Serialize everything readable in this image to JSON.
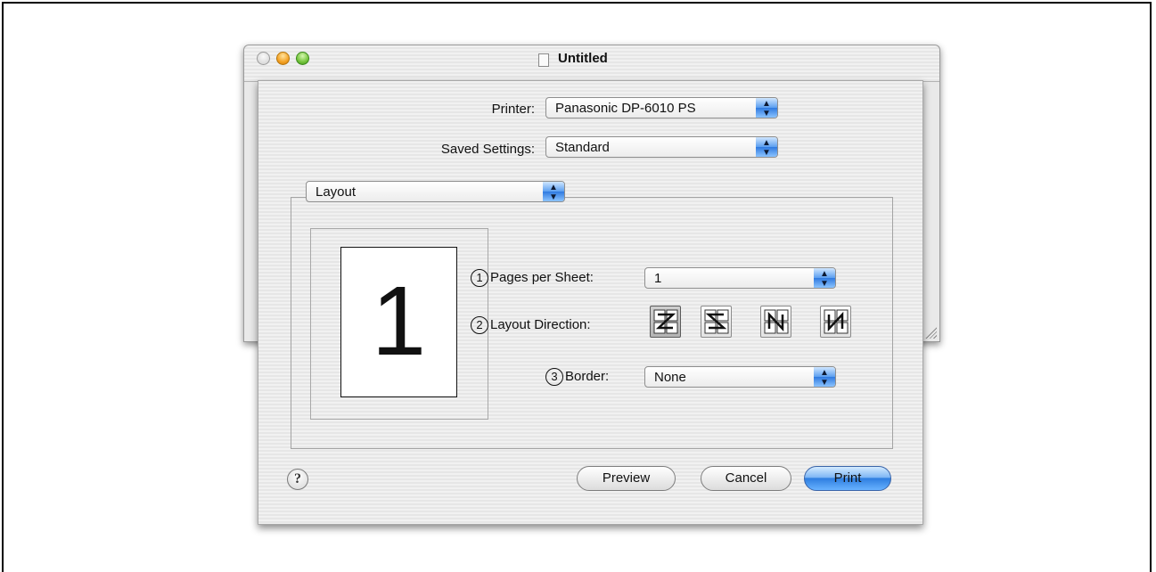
{
  "window": {
    "title": "Untitled"
  },
  "printer": {
    "label": "Printer:",
    "value": "Panasonic DP-6010 PS"
  },
  "saved_settings": {
    "label": "Saved Settings:",
    "value": "Standard"
  },
  "panel": {
    "value": "Layout"
  },
  "preview": {
    "page_number": "1"
  },
  "pages_per_sheet": {
    "marker": "1",
    "label": "Pages per Sheet:",
    "value": "1"
  },
  "layout_direction": {
    "marker": "2",
    "label": "Layout Direction:",
    "options": [
      "z-order",
      "reverse-z-order",
      "n-reverse",
      "n-order"
    ],
    "selected_index": 0
  },
  "border": {
    "marker": "3",
    "label": "Border:",
    "value": "None"
  },
  "buttons": {
    "help": "?",
    "preview": "Preview",
    "cancel": "Cancel",
    "print": "Print"
  },
  "colors": {
    "default_button": "#2e7ee0",
    "popup_arrow": "#5a9ef0"
  }
}
